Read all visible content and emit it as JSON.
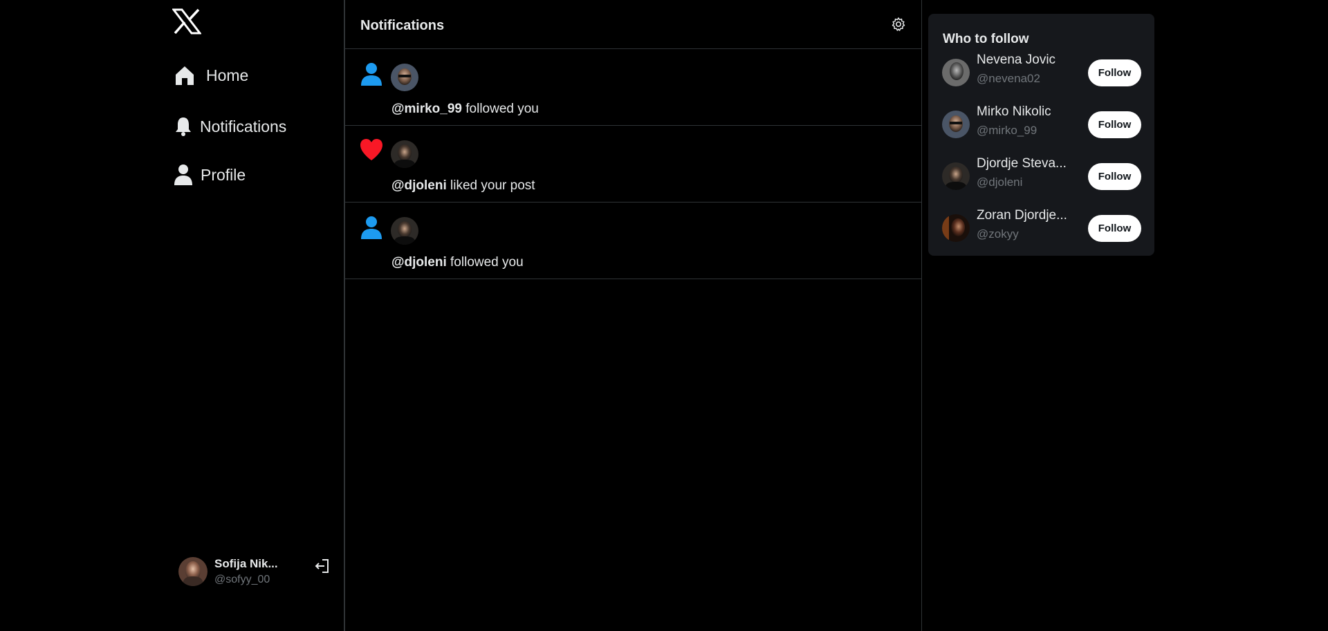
{
  "colors": {
    "background": "#000000",
    "panel": "#16181c",
    "border": "#2f3336",
    "text": "#e7e9ea",
    "muted": "#71767b",
    "follow_icon": "#1d9bf0",
    "like_icon": "#f91880"
  },
  "nav": {
    "logo_icon": "x-logo-icon",
    "items": [
      {
        "label": "Home",
        "icon": "home-icon"
      },
      {
        "label": "Notifications",
        "icon": "bell-icon"
      },
      {
        "label": "Profile",
        "icon": "person-icon"
      }
    ]
  },
  "account": {
    "name": "Sofija Nik...",
    "handle": "@sofyy_00",
    "logout_icon": "logout-icon"
  },
  "main": {
    "title": "Notifications",
    "settings_icon": "gear-icon",
    "notifications": [
      {
        "type_icon": "person-icon",
        "handle": "@mirko_99",
        "text": " followed you"
      },
      {
        "type_icon": "heart-icon",
        "handle": "@djoleni",
        "text": " liked your post"
      },
      {
        "type_icon": "person-icon",
        "handle": "@djoleni",
        "text": " followed you"
      }
    ]
  },
  "who_to_follow": {
    "title": "Who to follow",
    "button_label": "Follow",
    "users": [
      {
        "name": "Nevena Jovic",
        "handle": "@nevena02"
      },
      {
        "name": "Mirko Nikolic",
        "handle": "@mirko_99"
      },
      {
        "name": "Djordje Steva...",
        "handle": "@djoleni"
      },
      {
        "name": "Zoran Djordje...",
        "handle": "@zokyy"
      }
    ]
  }
}
